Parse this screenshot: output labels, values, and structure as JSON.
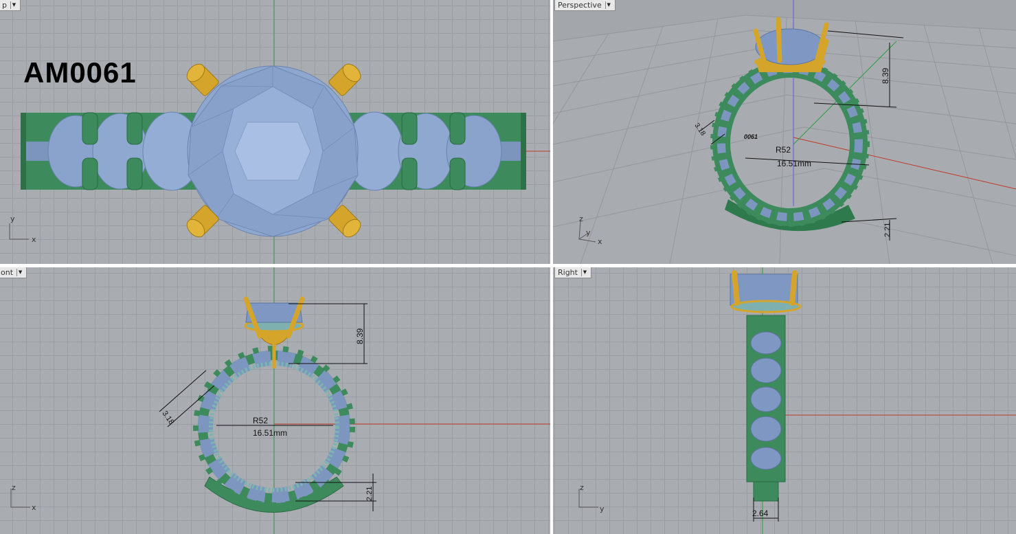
{
  "viewports": {
    "top": {
      "label": "p",
      "model_code": "AM0061",
      "axis_labels": [
        "y",
        "x"
      ]
    },
    "perspective": {
      "label": "Perspective",
      "axis_labels": [
        "z",
        "y",
        "x"
      ],
      "dims": {
        "height": "8.39",
        "width": "3.18",
        "radius": "R52",
        "diameter": "16.51mm",
        "band": "2.21",
        "engraving": "0061"
      }
    },
    "front": {
      "label": "ont",
      "axis_labels": [
        "z",
        "x"
      ],
      "dims": {
        "height": "8.39",
        "width": "3.18",
        "radius": "R52",
        "diameter": "16.51mm",
        "band": "2.21"
      }
    },
    "right": {
      "label": "Right",
      "axis_labels": [
        "z",
        "y"
      ],
      "dims": {
        "thickness": "2.64"
      }
    }
  },
  "colors": {
    "viewport_bg": "#a9acb1",
    "grid": "#9a9da2",
    "gem": "#8fa8cf",
    "band": "#3d8a5c",
    "prong": "#d4a52a",
    "axis_x": "#c0392b",
    "axis_y": "#2e9e3e",
    "axis_z": "#5b5bd6"
  }
}
